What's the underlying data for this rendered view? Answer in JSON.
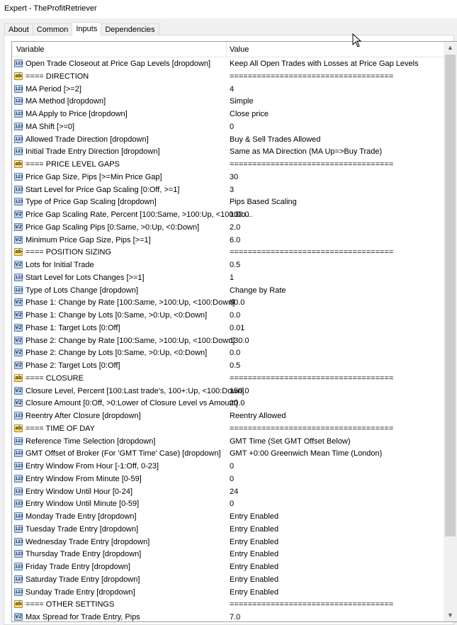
{
  "window": {
    "title": "Expert - TheProfitRetriever"
  },
  "tabs": [
    {
      "label": "About"
    },
    {
      "label": "Common"
    },
    {
      "label": "Inputs"
    },
    {
      "label": "Dependencies"
    }
  ],
  "active_tab": "Inputs",
  "grid": {
    "col_variable": "Variable",
    "col_value": "Value",
    "rows": [
      {
        "icon": "int",
        "name": "Open Trade Closeout at Price Gap Levels [dropdown]",
        "value": "Keep All Open Trades with Losses at Price Gap Levels"
      },
      {
        "icon": "ab",
        "name": "==== DIRECTION",
        "value": "===================================="
      },
      {
        "icon": "int",
        "name": "MA Period [>=2]",
        "value": "4"
      },
      {
        "icon": "int",
        "name": "MA Method [dropdown]",
        "value": "Simple"
      },
      {
        "icon": "int",
        "name": "MA Apply to Price [dropdown]",
        "value": "Close price"
      },
      {
        "icon": "int",
        "name": "MA Shift [>=0]",
        "value": "0"
      },
      {
        "icon": "int",
        "name": "Allowed Trade Direction [dropdown]",
        "value": "Buy & Sell Trades Allowed"
      },
      {
        "icon": "int",
        "name": "Initial Trade Entry Direction [dropdown]",
        "value": "Same as MA Direction (MA Up=>Buy Trade)"
      },
      {
        "icon": "ab",
        "name": "==== PRICE LEVEL GAPS",
        "value": "===================================="
      },
      {
        "icon": "int",
        "name": "Price Gap Size, Pips [>=Min Price Gap]",
        "value": "30"
      },
      {
        "icon": "int",
        "name": "Start Level for Price Gap Scaling [0:Off, >=1]",
        "value": "3"
      },
      {
        "icon": "int",
        "name": "Type of Price Gap Scaling [dropdown]",
        "value": "Pips Based Scaling"
      },
      {
        "icon": "dbl",
        "name": "Price Gap Scaling Rate, Percent [100:Same, >100:Up, <100:Do...",
        "value": "100.0"
      },
      {
        "icon": "dbl",
        "name": "Price Gap Scaling Pips [0:Same, >0:Up, <0:Down]",
        "value": "2.0"
      },
      {
        "icon": "dbl",
        "name": "Minimum Price Gap Size, Pips [>=1]",
        "value": "6.0"
      },
      {
        "icon": "ab",
        "name": "==== POSITION SIZING",
        "value": "===================================="
      },
      {
        "icon": "dbl",
        "name": "Lots for Initial Trade",
        "value": "0.5"
      },
      {
        "icon": "int",
        "name": "Start Level for Lots Changes [>=1]",
        "value": "1"
      },
      {
        "icon": "int",
        "name": "Type of Lots Change [dropdown]",
        "value": "Change by Rate"
      },
      {
        "icon": "dbl",
        "name": "Phase 1: Change by Rate [100:Same, >100:Up, <100:Down]",
        "value": "80.0"
      },
      {
        "icon": "dbl",
        "name": "Phase 1: Change by Lots [0:Same, >0:Up, <0:Down]",
        "value": "0.0"
      },
      {
        "icon": "dbl",
        "name": "Phase 1: Target Lots [0:Off]",
        "value": "0.01"
      },
      {
        "icon": "dbl",
        "name": "Phase 2: Change by Rate [100:Same, >100:Up, <100:Down]",
        "value": "130.0"
      },
      {
        "icon": "dbl",
        "name": "Phase 2: Change by Lots [0:Same, >0:Up, <0:Down]",
        "value": "0.0"
      },
      {
        "icon": "dbl",
        "name": "Phase 2: Target Lots [0:Off]",
        "value": "0.5"
      },
      {
        "icon": "ab",
        "name": "==== CLOSURE",
        "value": "===================================="
      },
      {
        "icon": "dbl",
        "name": "Closure Level, Percent [100:Last trade's, 100+:Up, <100:Down]",
        "value": "150.0"
      },
      {
        "icon": "dbl",
        "name": "Closure Amount [0:Off, >0:Lower of Closure Level vs Amount]",
        "value": "20.0"
      },
      {
        "icon": "int",
        "name": "Reentry After Closure [dropdown]",
        "value": "Reentry Allowed"
      },
      {
        "icon": "ab",
        "name": "==== TIME OF DAY",
        "value": "===================================="
      },
      {
        "icon": "int",
        "name": "Reference Time Selection [dropdown]",
        "value": "GMT Time (Set GMT Offset Below)"
      },
      {
        "icon": "int",
        "name": "GMT Offset of Broker (For 'GMT Time' Case) [dropdown]",
        "value": "GMT +0:00  Greenwich Mean Time (London)"
      },
      {
        "icon": "int",
        "name": "Entry Window From Hour [-1:Off, 0-23]",
        "value": "0"
      },
      {
        "icon": "int",
        "name": "Entry Window From Minute [0-59]",
        "value": "0"
      },
      {
        "icon": "int",
        "name": "Entry Window Until Hour [0-24]",
        "value": "24"
      },
      {
        "icon": "int",
        "name": "Entry Window Until Minute [0-59]",
        "value": "0"
      },
      {
        "icon": "int",
        "name": "Monday Trade Entry [dropdown]",
        "value": "Entry Enabled"
      },
      {
        "icon": "int",
        "name": "Tuesday Trade Entry [dropdown]",
        "value": "Entry Enabled"
      },
      {
        "icon": "int",
        "name": "Wednesday Trade Entry [dropdown]",
        "value": "Entry Enabled"
      },
      {
        "icon": "int",
        "name": "Thursday Trade Entry [dropdown]",
        "value": "Entry Enabled"
      },
      {
        "icon": "int",
        "name": "Friday Trade Entry [dropdown]",
        "value": "Entry Enabled"
      },
      {
        "icon": "int",
        "name": "Saturday Trade Entry [dropdown]",
        "value": "Entry Enabled"
      },
      {
        "icon": "int",
        "name": "Sunday Trade Entry [dropdown]",
        "value": "Entry Enabled"
      },
      {
        "icon": "ab",
        "name": "==== OTHER SETTINGS",
        "value": "===================================="
      },
      {
        "icon": "dbl",
        "name": "Max Spread for Trade Entry, Pips",
        "value": "7.0"
      }
    ]
  },
  "icon_labels": {
    "int": "123",
    "dbl": "V2",
    "ab": "ab"
  },
  "colors": {
    "row_selected": "#ffffff",
    "accent": "#0078d7"
  }
}
